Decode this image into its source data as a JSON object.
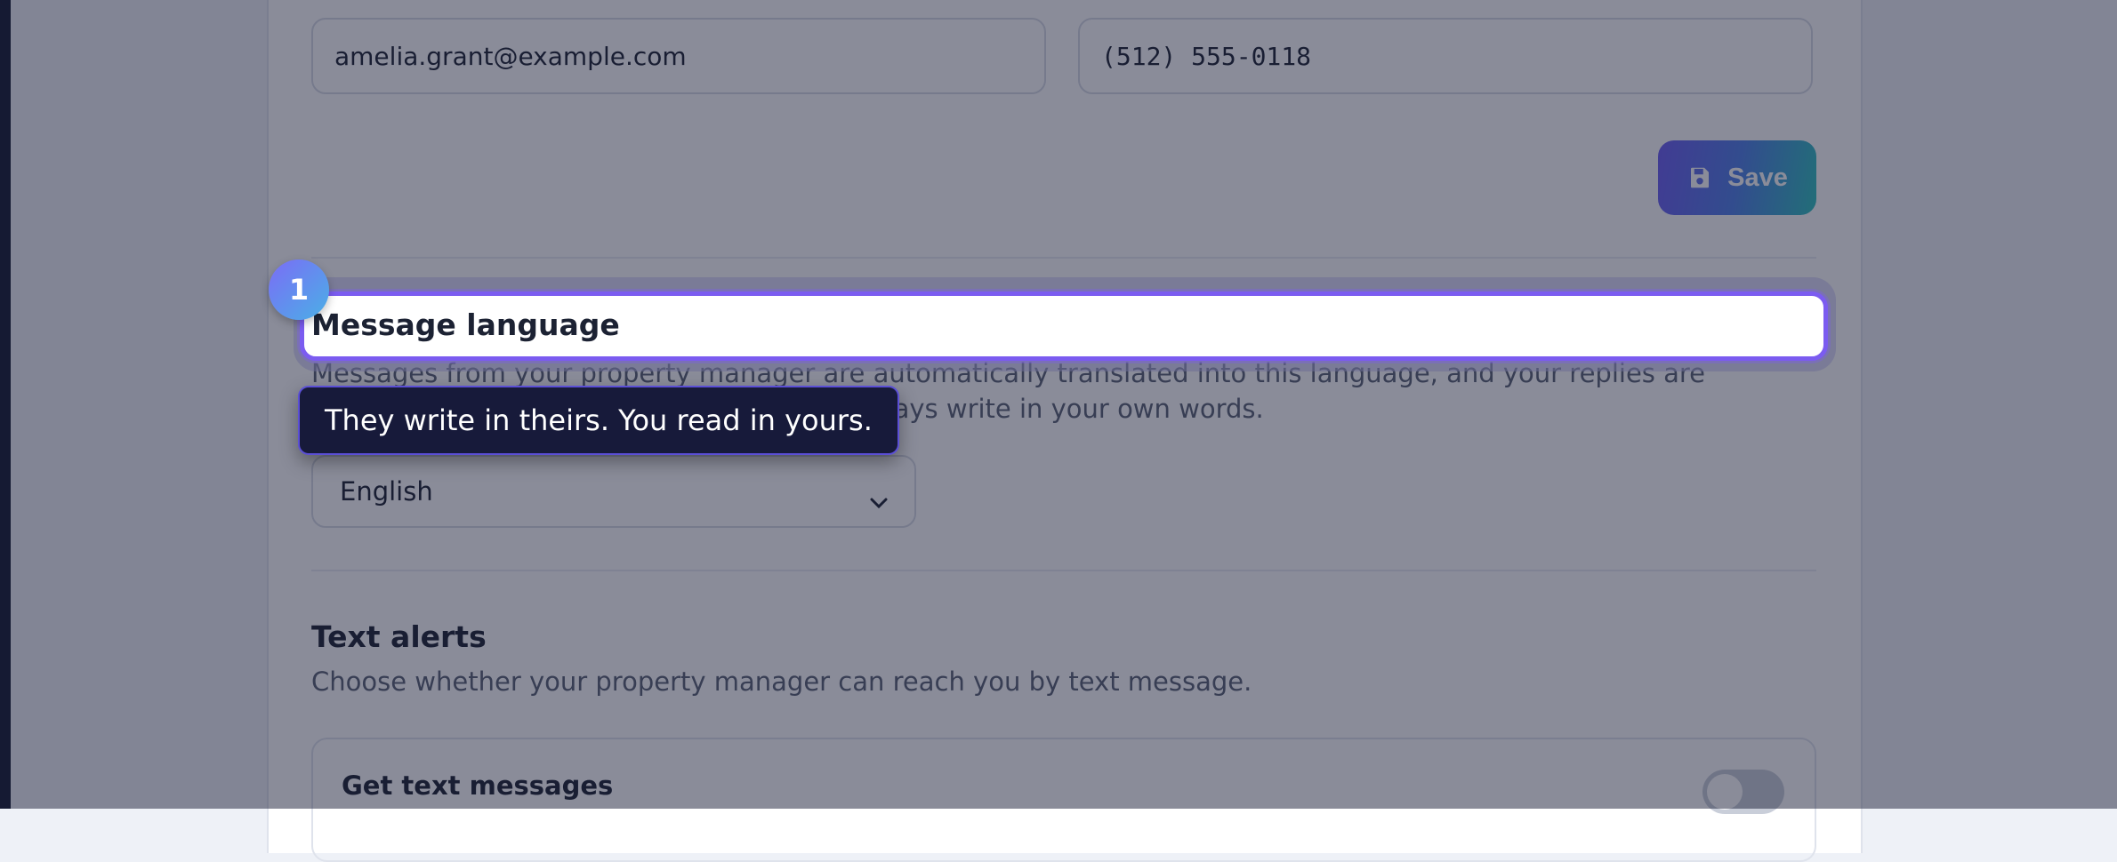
{
  "contact": {
    "email_value": "amelia.grant@example.com",
    "phone_value": "(512) 555-0118",
    "save_label": "Save"
  },
  "message_language": {
    "title": "Message language",
    "description": "Messages from your property manager are automatically translated into this language, and your replies are translated into their language — you can always write in your own words.",
    "selected": "English"
  },
  "text_alerts": {
    "title": "Text alerts",
    "description": "Choose whether your property manager can reach you by text message.",
    "toggle_label": "Get text messages",
    "toggle_on": false
  },
  "tour": {
    "step_number": "1",
    "tooltip": "They write in theirs. You read in yours."
  },
  "colors": {
    "accent": "#7b5cf0",
    "tooltip_bg": "#171a3a",
    "rail": "#151a33"
  }
}
